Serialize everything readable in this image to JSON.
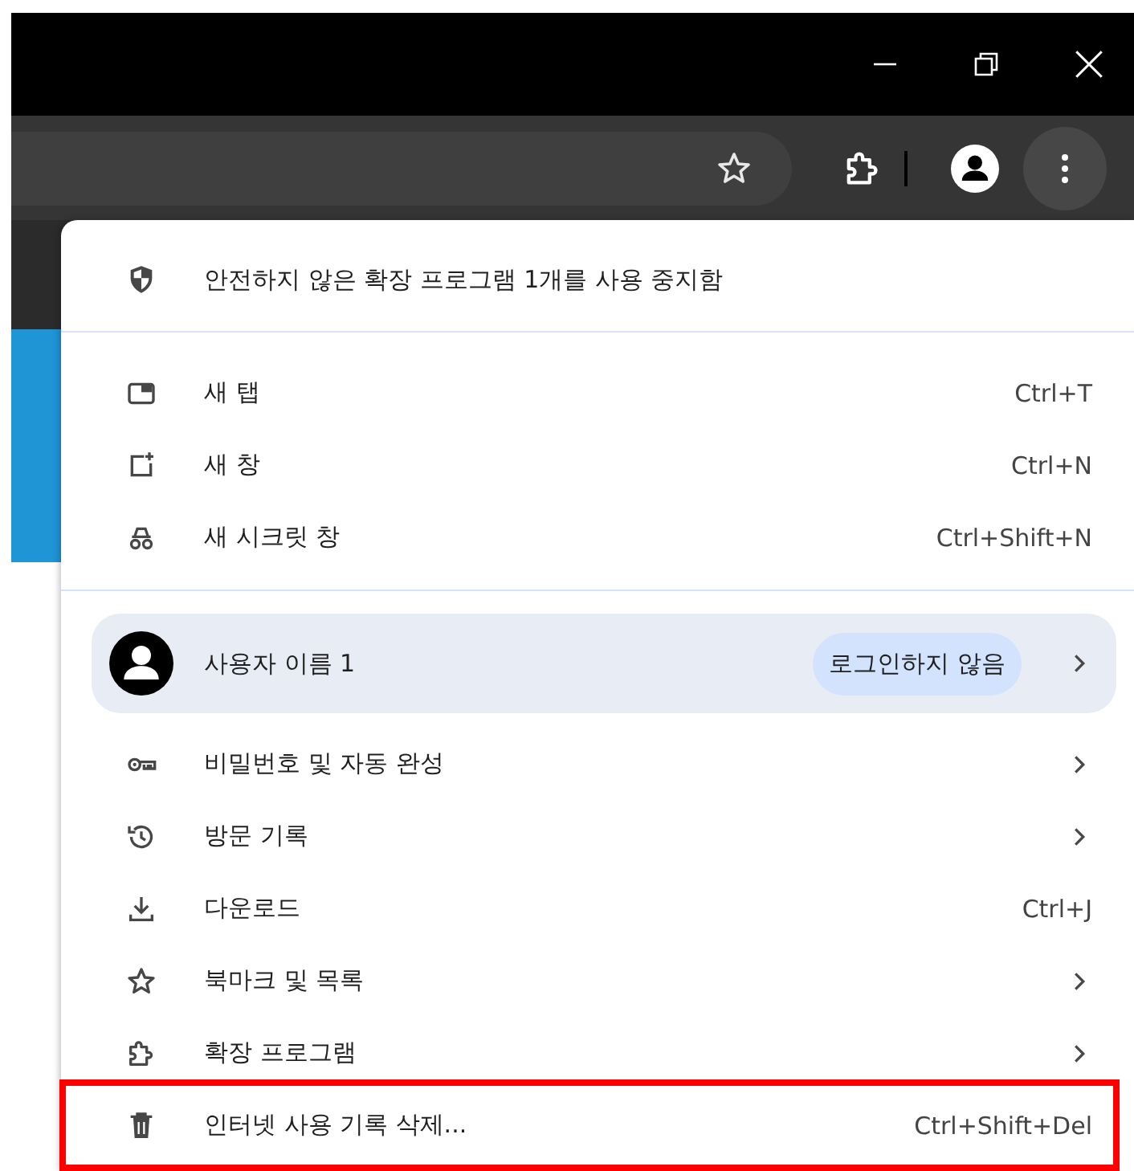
{
  "menu": {
    "items": [
      {
        "kind": "notice",
        "label": "안전하지 않은 확장 프로그램 1개를 사용 중지함",
        "highlighted": false
      },
      {
        "kind": "separator"
      },
      {
        "kind": "item",
        "label": "새 탭",
        "shortcut": "Ctrl+T",
        "submenu": false,
        "highlighted": false
      },
      {
        "kind": "item",
        "label": "새 창",
        "shortcut": "Ctrl+N",
        "submenu": false,
        "highlighted": false
      },
      {
        "kind": "item",
        "label": "새 시크릿 창",
        "shortcut": "Ctrl+Shift+N",
        "submenu": false,
        "highlighted": false
      },
      {
        "kind": "separator"
      },
      {
        "kind": "profile",
        "label": "사용자 이름 1",
        "badge": "로그인하지 않음",
        "submenu": true,
        "highlighted": false
      },
      {
        "kind": "item",
        "label": "비밀번호 및 자동 완성",
        "submenu": true,
        "highlighted": false
      },
      {
        "kind": "item",
        "label": "방문 기록",
        "submenu": true,
        "highlighted": false
      },
      {
        "kind": "item",
        "label": "다운로드",
        "shortcut": "Ctrl+J",
        "submenu": false,
        "highlighted": false
      },
      {
        "kind": "item",
        "label": "북마크 및 목록",
        "submenu": true,
        "highlighted": false
      },
      {
        "kind": "item",
        "label": "확장 프로그램",
        "submenu": true,
        "highlighted": false
      },
      {
        "kind": "item",
        "label": "인터넷 사용 기록 삭제...",
        "shortcut": "Ctrl+Shift+Del",
        "submenu": false,
        "highlighted": true
      }
    ]
  }
}
